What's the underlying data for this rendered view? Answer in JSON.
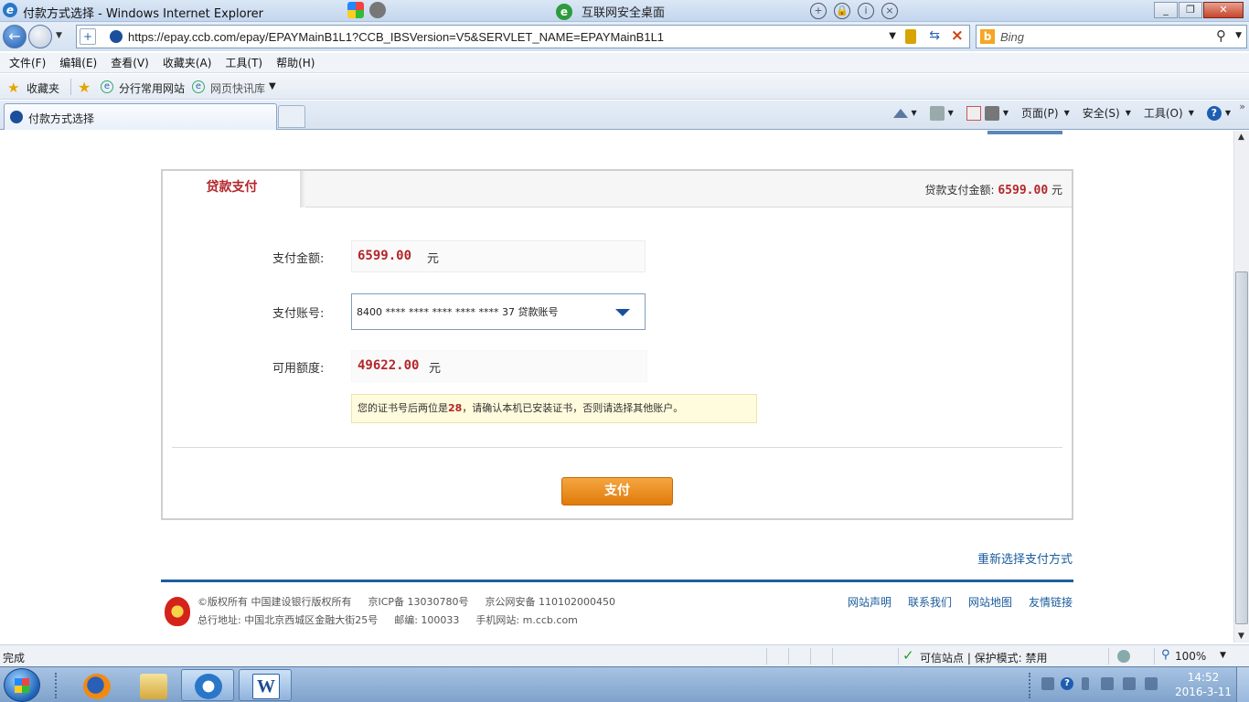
{
  "window": {
    "title": "付款方式选择 - Windows Internet Explorer",
    "center_tab_label": "互联网安全桌面"
  },
  "address_bar": {
    "url": "https://epay.ccb.com/epay/EPAYMainB1L1?CCB_IBSVersion=V5&SERVLET_NAME=EPAYMainB1L1",
    "search_placeholder": "Bing"
  },
  "menu": [
    "文件(F)",
    "编辑(E)",
    "查看(V)",
    "收藏夹(A)",
    "工具(T)",
    "帮助(H)"
  ],
  "favorites_bar": {
    "favorites_label": "收藏夹",
    "link1": "分行常用网站",
    "link2": "网页快讯库"
  },
  "tab": {
    "label": "付款方式选择"
  },
  "command_bar": {
    "page": "页面(P)",
    "safety": "安全(S)",
    "tools": "工具(O)"
  },
  "payment": {
    "tab_title": "贷款支付",
    "header_amount_label": "贷款支付金额:",
    "header_amount": "6599.00",
    "currency_unit": "元",
    "amount_label": "支付金额:",
    "amount": "6599.00",
    "account_label": "支付账号:",
    "account_value": "8400 **** **** **** **** **** 37 贷款账号",
    "credit_label": "可用额度:",
    "credit": "49622.00",
    "notice_pre": "您的证书号后两位是",
    "notice_cert": "28",
    "notice_post": "，请确认本机已安装证书，否则请选择其他账户。",
    "pay_button": "支付",
    "reselect_link": "重新选择支付方式"
  },
  "footer": {
    "copyright": "©版权所有 中国建设银行版权所有",
    "icp": "京ICP备 13030780号",
    "police": "京公网安备 110102000450",
    "address": "总行地址: 中国北京西城区金融大街25号",
    "postcode": "邮编: 100033",
    "mobile": "手机网站: m.ccb.com",
    "links": [
      "网站声明",
      "联系我们",
      "网站地图",
      "友情链接"
    ]
  },
  "status_bar": {
    "status": "完成",
    "zone": "可信站点 | 保护模式: 禁用",
    "zoom": "100%"
  },
  "taskbar": {
    "time": "14:52",
    "date": "2016-3-11"
  },
  "colors": {
    "accent_red": "#b3262a",
    "pay_button": "#e07b0a",
    "link_blue": "#1a5b9c",
    "footer_line": "#1b5fa0"
  }
}
